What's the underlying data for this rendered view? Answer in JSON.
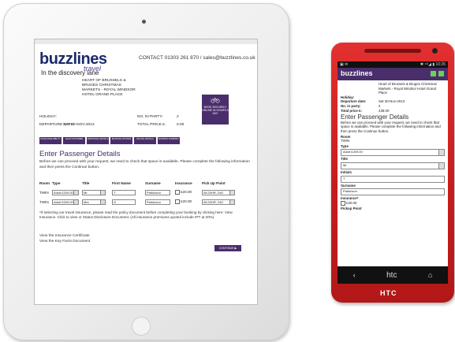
{
  "tablet": {
    "brand": "buzz",
    "brand2": "ines",
    "brand_travel": "travel",
    "tagline": "In the discovery lane",
    "contact": "CONTACT 01303 261 870 / sales@buzzlines.co.uk",
    "holiday_place": "HEART OF BRUSSELS & BRUGES CHRISTMAS MARKETS - ROYAL WINDSOR HOTEL GRAND PLACE",
    "holiday_label": "HOLIDAY:",
    "departure_label": "DEPARTURE DATE:",
    "departure_value": "SAT 30-NOV-2013",
    "party_label": "NO. IN PARTY:",
    "party_value": "2",
    "price_label": "TOTAL PRICE £:",
    "price_value": "0.00",
    "book_box": "BOOK SECURELY ONLINE 24 HOURS A DAY",
    "steps": [
      "ROOM AVAILABILITY",
      "LEAD CUSTOMER",
      "ADDITIONAL DETAILS",
      "BOOKING OPTIONS",
      "BILLING DETAILS",
      "BOOKING SUMMARY"
    ],
    "enter_title": "Enter Passenger Details",
    "enter_desc": "Before we can proceed with your request, we need to check that space is available. Please complete the following information and then press the Continue button.",
    "table_headers": [
      "Room",
      "Type",
      "Title",
      "First Name",
      "Surname",
      "Insurance",
      "Pick Up Point"
    ],
    "rows": [
      {
        "room": "TWIN",
        "type": "Adult £209.00",
        "title": "Mr",
        "first": "T",
        "surname": "Parkinson",
        "insurance": "£20.00",
        "pickup": "08:20HR, DIG"
      },
      {
        "room": "TWIN",
        "type": "Adult £209.00",
        "title": "Mrs",
        "first": "G",
        "surname": "Parkinson",
        "insurance": "£20.00",
        "pickup": "08:20HR, DIG"
      }
    ],
    "insurance_note": "*If selecting our travel insurance, please read the policy document before completing your booking by clicking here: View Insurance. Click to view or Status Disclosure Document. (All insurance premiums quoted include IPT at 20%)",
    "link1": "View the Insurance Certificate",
    "link2": "View the Key Facts Document",
    "continue": "CONTINUE ▶"
  },
  "phone": {
    "status_left": "▣ ✉",
    "status_right": "✱ ⁴ᴳ◢ ▮ 10:26",
    "brand": "buzzlines",
    "holiday_place": "Heart of Brussels & Bruges Christmas Markets - Royal Windsor Hotel Grand Place",
    "holiday_label": "Holiday:",
    "departure_label": "Departure date:",
    "departure_value": "Sat 30-Nov-2013",
    "party_label": "No. in party:",
    "party_value": "2",
    "price_label": "Total price £:",
    "price_value": "438.00",
    "enter_title": "Enter Passenger Details",
    "enter_desc": "Before we can proceed with your request, we need to check that space is available. Please complete the following information and then press the Continue button.",
    "room_label": "Room",
    "room_value": "TWIN",
    "type_label": "Type",
    "type_value": "Adult £209.00",
    "title_label": "Title",
    "title_value": "Mr",
    "initials_label": "Initials",
    "initials_value": "T",
    "surname_label": "Surname",
    "surname_value": "Parkinson",
    "insurance_label": "Insurance*",
    "insurance_value": "£20.00",
    "pickup_label": "Pickup Point",
    "nav_back": "‹",
    "nav_brand": "htc",
    "nav_home": "⌂",
    "htc_label": "HTC"
  },
  "colors": {
    "accent": "#4a2e6c",
    "phone_body": "#d02222",
    "brand_navy": "#1b2a6b"
  }
}
